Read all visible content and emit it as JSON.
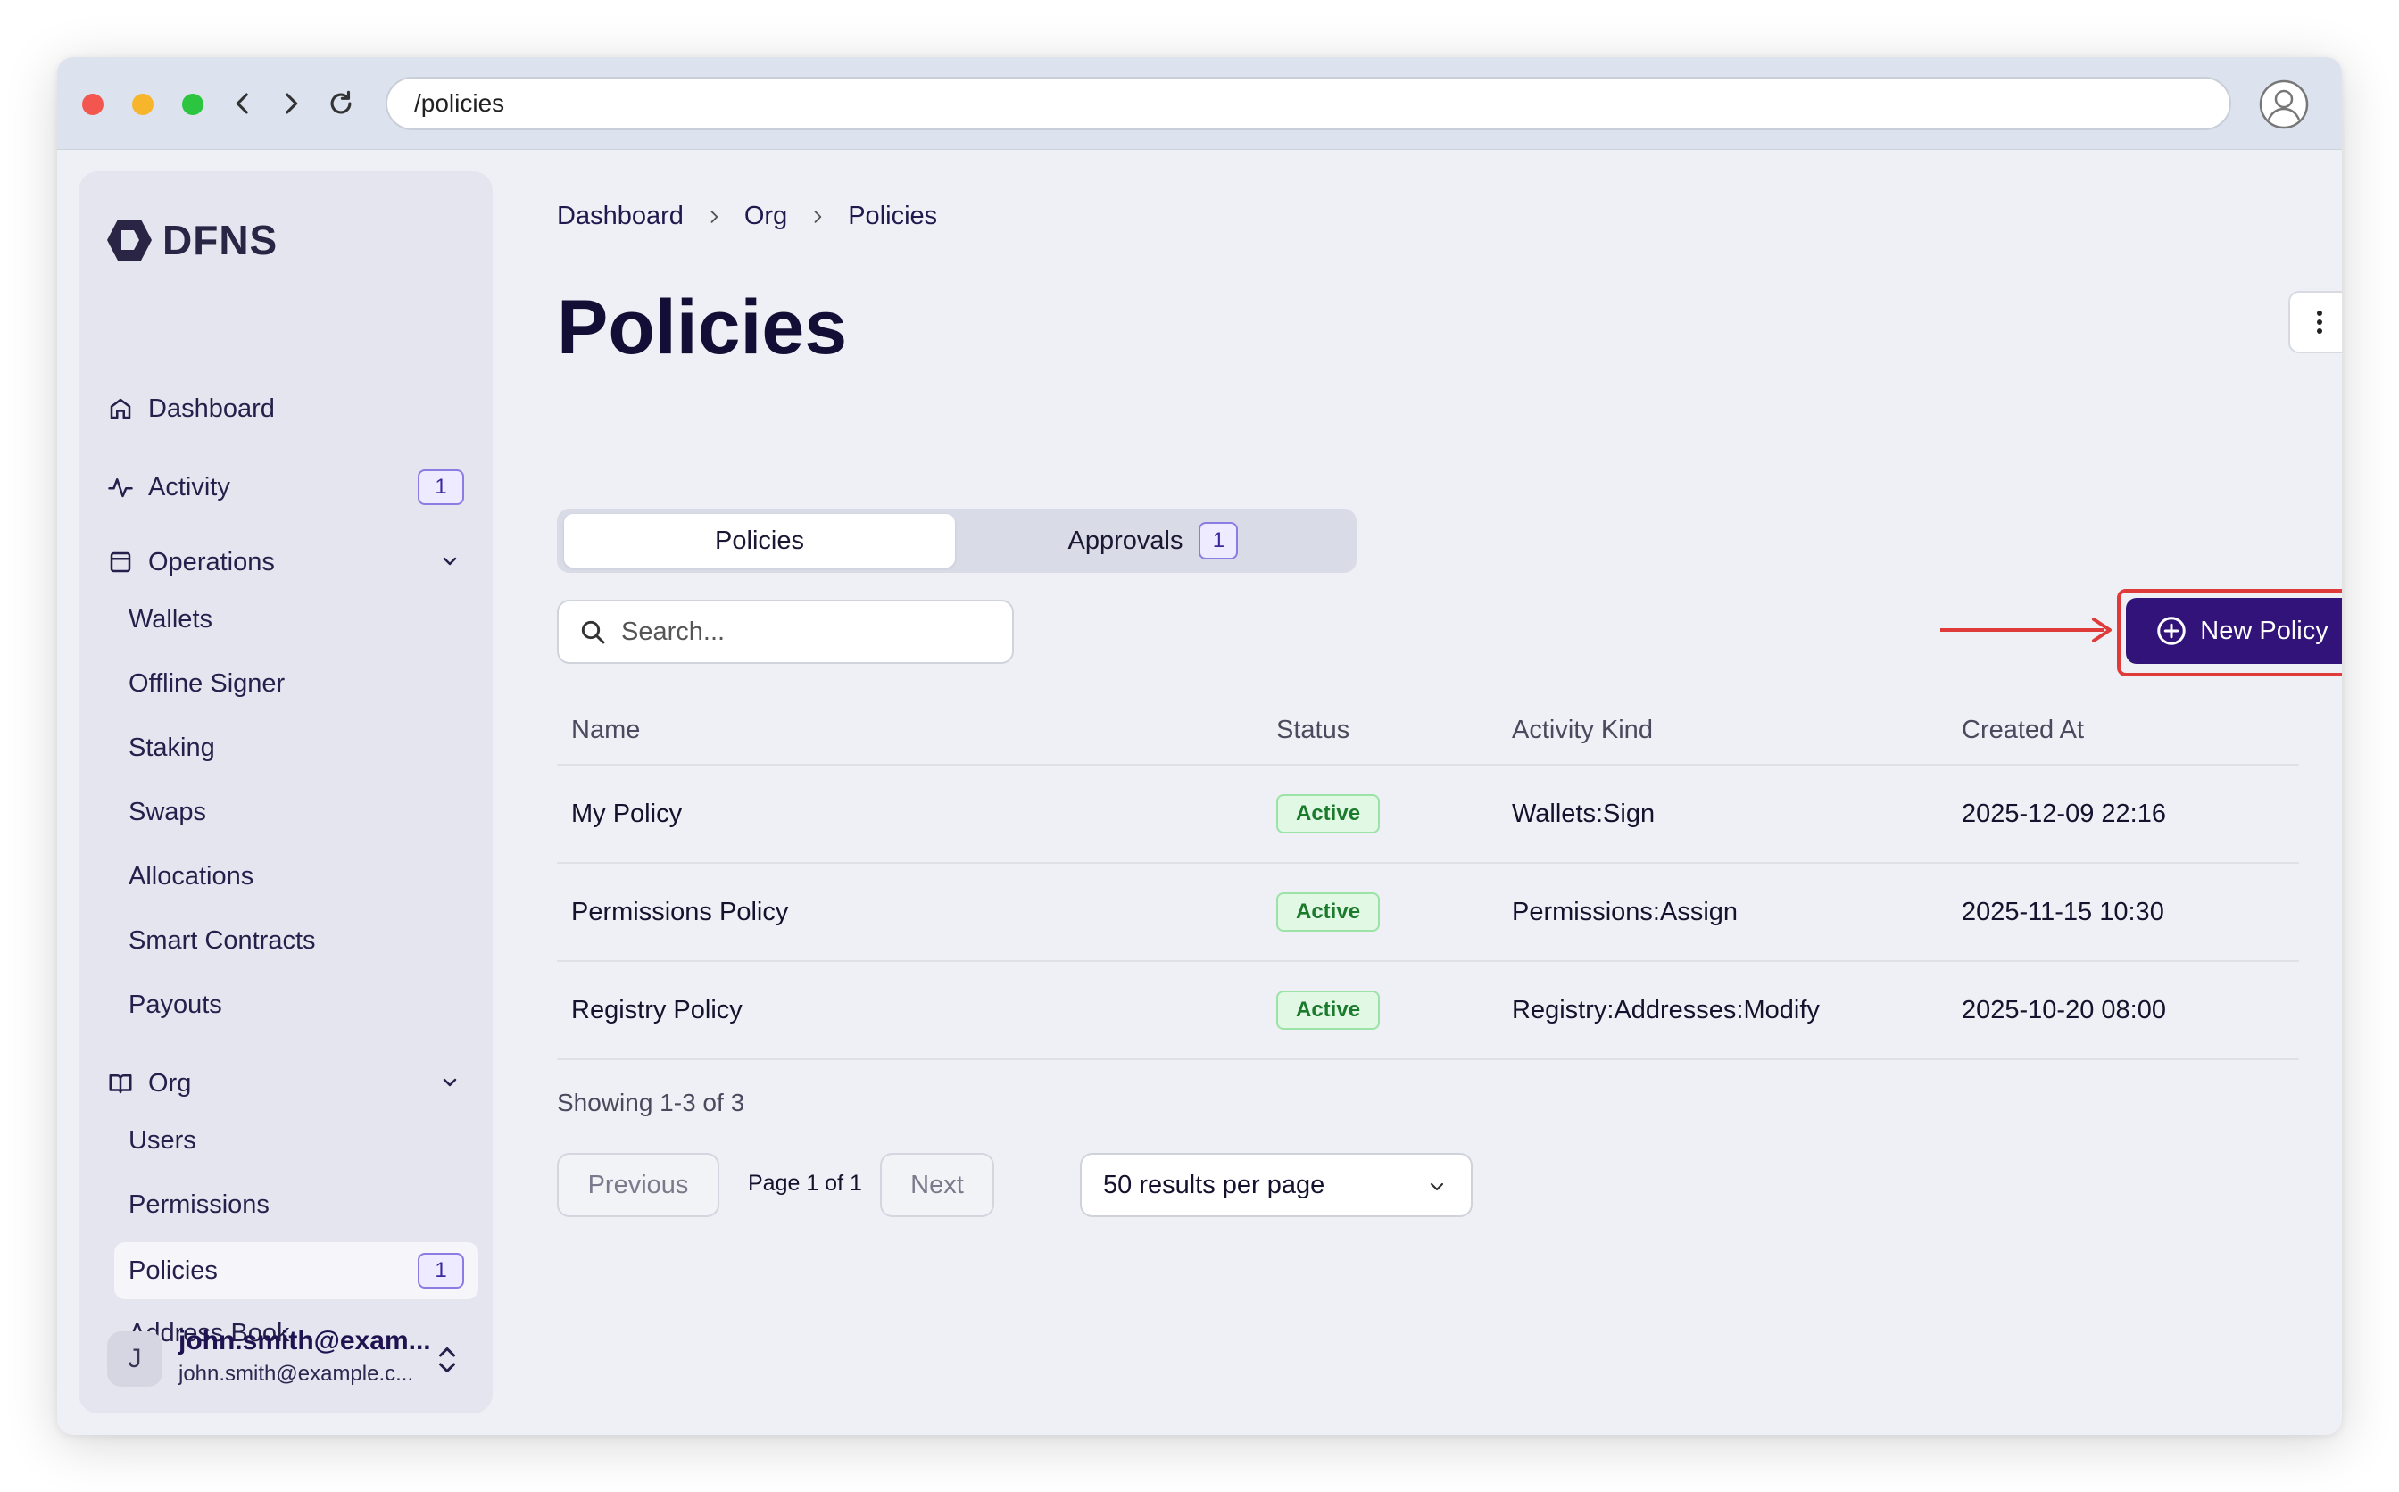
{
  "browser": {
    "url": "/policies"
  },
  "sidebar": {
    "logo": "DFNS",
    "items": [
      {
        "label": "Dashboard"
      },
      {
        "label": "Activity",
        "badge": "1"
      },
      {
        "label": "Operations"
      },
      {
        "label": "Wallets"
      },
      {
        "label": "Offline Signer"
      },
      {
        "label": "Staking"
      },
      {
        "label": "Swaps"
      },
      {
        "label": "Allocations"
      },
      {
        "label": "Smart Contracts"
      },
      {
        "label": "Payouts"
      },
      {
        "label": "Org"
      },
      {
        "label": "Users"
      },
      {
        "label": "Permissions"
      },
      {
        "label": "Policies",
        "badge": "1"
      },
      {
        "label": "Address Book"
      }
    ],
    "user": {
      "initial": "J",
      "name": "john.smith@exam...",
      "email": "john.smith@example.c..."
    }
  },
  "breadcrumb": [
    "Dashboard",
    "Org",
    "Policies"
  ],
  "page": {
    "title": "Policies"
  },
  "tabs": [
    {
      "label": "Policies"
    },
    {
      "label": "Approvals",
      "badge": "1"
    }
  ],
  "search": {
    "placeholder": "Search..."
  },
  "new_policy_label": "New Policy",
  "table": {
    "headers": [
      "Name",
      "Status",
      "Activity Kind",
      "Created At"
    ],
    "rows": [
      {
        "name": "My Policy",
        "status": "Active",
        "kind": "Wallets:Sign",
        "created": "2025-12-09 22:16"
      },
      {
        "name": "Permissions Policy",
        "status": "Active",
        "kind": "Permissions:Assign",
        "created": "2025-11-15 10:30"
      },
      {
        "name": "Registry Policy",
        "status": "Active",
        "kind": "Registry:Addresses:Modify",
        "created": "2025-10-20 08:00"
      }
    ]
  },
  "pagination": {
    "showing": "Showing 1-3 of 3",
    "previous": "Previous",
    "page": "Page 1 of 1",
    "next": "Next",
    "per_page": "50 results per page"
  },
  "colors": {
    "primary": "#31137a",
    "highlight": "#e03b3b",
    "active_badge": "#1c7a2c"
  }
}
